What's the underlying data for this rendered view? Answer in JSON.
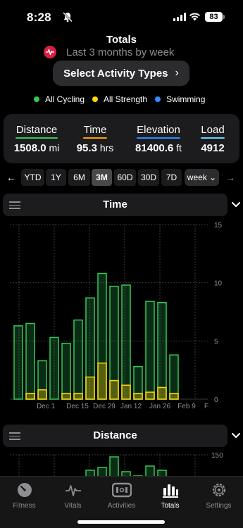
{
  "status": {
    "time": "8:28",
    "battery": "83"
  },
  "header": {
    "title": "Totals",
    "subtitle": "Last 3 months by week",
    "select_label": "Select Activity Types"
  },
  "legend": [
    {
      "label": "All Cycling",
      "color": "#35c759"
    },
    {
      "label": "All Strength",
      "color": "#ffd60a"
    },
    {
      "label": "Swimming",
      "color": "#2f8cff"
    }
  ],
  "stats": [
    {
      "label": "Distance",
      "value": "1508.0",
      "unit": "mi",
      "color": "#35c759"
    },
    {
      "label": "Time",
      "value": "95.3",
      "unit": "hrs",
      "color": "#ff9f0a"
    },
    {
      "label": "Elevation",
      "value": "81400.6",
      "unit": "ft",
      "color": "#2f8cff"
    },
    {
      "label": "Load",
      "value": "4912",
      "unit": "",
      "color": "#64d2ff"
    }
  ],
  "ranges": [
    "YTD",
    "1Y",
    "6M",
    "3M",
    "60D",
    "30D",
    "7D"
  ],
  "selected_range": "3M",
  "week_select": "week",
  "sections": {
    "time": "Time",
    "distance": "Distance"
  },
  "chart_data": [
    {
      "type": "bar",
      "title": "Time",
      "categories": [
        "",
        "Dec 1",
        "",
        "Dec 15",
        "",
        "Dec 29",
        "",
        "Jan 12",
        "",
        "Jan 26",
        "",
        "Feb 9",
        ""
      ],
      "x_tick_labels": [
        "Dec 1",
        "Dec 15",
        "Dec 29",
        "Jan 12",
        "Jan 26",
        "Feb 9",
        "F"
      ],
      "series": [
        {
          "name": "All Cycling",
          "values": [
            6.3,
            6.0,
            2.5,
            5.3,
            4.3,
            6.3,
            6.8,
            7.7,
            8.1,
            8.6,
            2.3,
            7.8,
            7.3,
            3.3
          ]
        },
        {
          "name": "All Strength",
          "values": [
            0,
            0.5,
            0.8,
            0,
            0.5,
            0.5,
            1.9,
            3.1,
            1.6,
            1.2,
            0.5,
            0.6,
            1.0,
            0.5
          ]
        }
      ],
      "ylim": [
        0,
        15
      ],
      "yticks": [
        0,
        5,
        10,
        15
      ],
      "grid": true
    },
    {
      "type": "bar",
      "title": "Distance",
      "yticks": [
        150
      ]
    }
  ],
  "tabs": [
    {
      "label": "Fitness",
      "icon": "gauge-icon"
    },
    {
      "label": "Vitals",
      "icon": "heartbeat-icon"
    },
    {
      "label": "Activities",
      "icon": "activities-icon"
    },
    {
      "label": "Totals",
      "icon": "bar-chart-icon"
    },
    {
      "label": "Settings",
      "icon": "gear-icon"
    }
  ],
  "active_tab": "Totals"
}
